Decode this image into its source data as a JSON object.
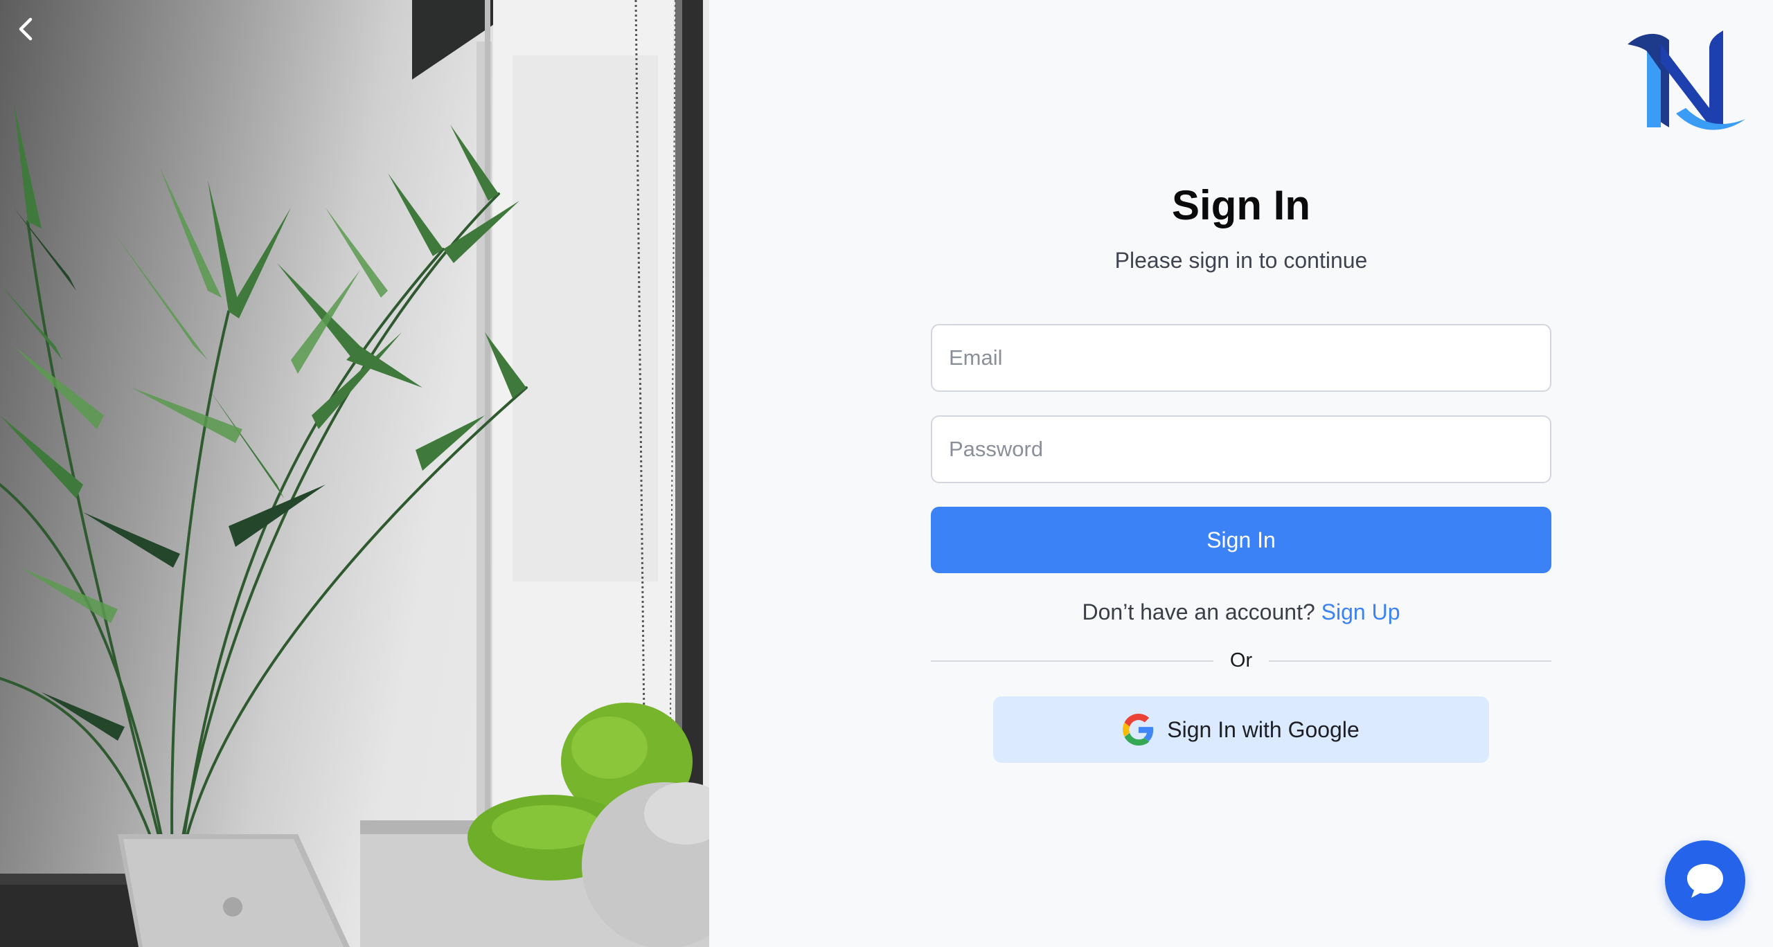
{
  "navigation": {
    "back_icon": "chevron-left-icon"
  },
  "brand": {
    "logo_letter": "N",
    "logo_colors": [
      "#1e40af",
      "#3b9cf6"
    ]
  },
  "signin": {
    "title": "Sign In",
    "subtitle": "Please sign in to continue",
    "email_placeholder": "Email",
    "password_placeholder": "Password",
    "submit_label": "Sign In",
    "no_account_text": "Don’t have an account? ",
    "signup_link": "Sign Up",
    "divider_text": "Or",
    "google_label": "Sign In with Google"
  },
  "chat": {
    "icon": "chat-bubble-icon"
  },
  "colors": {
    "accent": "#3b82f6",
    "google_button_bg": "#dbeafe",
    "chat_button": "#2563eb",
    "background": "#f8f9fb"
  }
}
